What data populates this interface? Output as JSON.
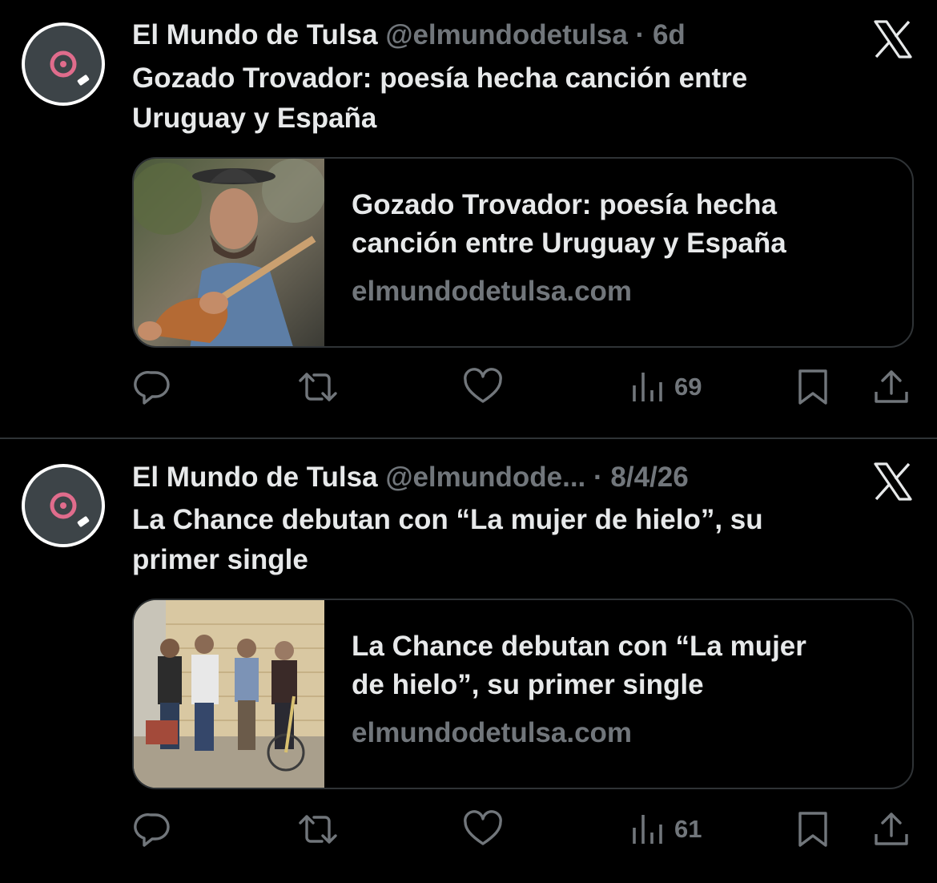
{
  "tweets": [
    {
      "display_name": "El Mundo de Tulsa",
      "handle": "@elmundodetulsa",
      "separator": "·",
      "time": "6d",
      "text_line1": "Gozado Trovador: poesía hecha canción entre",
      "text_line2": "Uruguay y España",
      "card_title_line1": "Gozado Trovador: poesía hecha",
      "card_title_line2": "canción entre Uruguay y España",
      "card_domain": "elmundodetulsa.com",
      "views": "69"
    },
    {
      "display_name": "El Mundo de Tulsa",
      "handle": "@elmundode...",
      "separator": "·",
      "time": "8/4/26",
      "text_line1": "La Chance debutan con “La mujer de hielo”, su",
      "text_line2": "primer single",
      "card_title_line1": "La Chance debutan con “La mujer",
      "card_title_line2": "de hielo”, su primer single",
      "card_domain": "elmundodetulsa.com",
      "views": "61"
    }
  ],
  "icons": {
    "avatar": "vinyl-record-icon",
    "logo": "x-logo-icon",
    "reply": "reply-icon",
    "retweet": "retweet-icon",
    "like": "heart-icon",
    "views": "views-bar-chart-icon",
    "bookmark": "bookmark-icon",
    "share": "share-icon"
  },
  "colors": {
    "background": "#000000",
    "text": "#e7e9ea",
    "muted": "#71767b",
    "border": "#2f3336",
    "avatar_accent": "#e06c8c"
  }
}
